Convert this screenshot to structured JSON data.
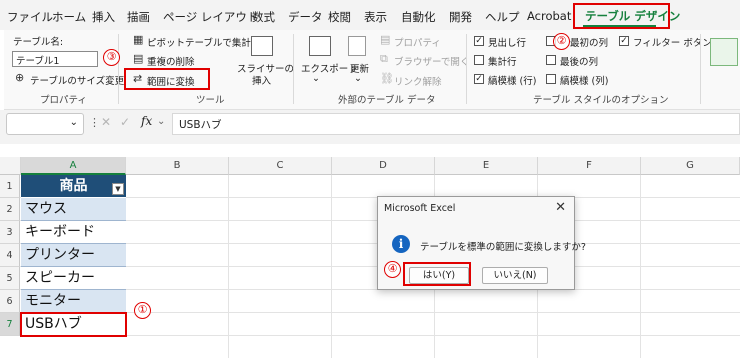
{
  "tabs": [
    "ファイル",
    "ホーム",
    "挿入",
    "描画",
    "ページ レイアウト",
    "数式",
    "データ",
    "校閲",
    "表示",
    "自動化",
    "開発",
    "ヘルプ",
    "Acrobat",
    "テーブル デザイン"
  ],
  "ribbon": {
    "properties": {
      "table_name_label": "テーブル名:",
      "table_name_value": "テーブル1",
      "resize_label": "テーブルのサイズ変更",
      "group_label": "プロパティ"
    },
    "tools": {
      "pivot_label": "ピボットテーブルで集計",
      "remove_dup_label": "重複の削除",
      "convert_label": "範囲に変換",
      "slicer_label_1": "スライサーの",
      "slicer_label_2": "挿入",
      "group_label": "ツール"
    },
    "external": {
      "export_label": "エクスポート",
      "refresh_label": "更新",
      "properties_label": "プロパティ",
      "browser_label": "ブラウザーで開く",
      "unlink_label": "リンク解除",
      "group_label": "外部のテーブル データ"
    },
    "style_options": {
      "header_row": {
        "label": "見出し行",
        "checked": true
      },
      "total_row": {
        "label": "集計行",
        "checked": false
      },
      "banded_rows": {
        "label": "縞模様 (行)",
        "checked": true
      },
      "first_column": {
        "label": "最初の列",
        "checked": false
      },
      "last_column": {
        "label": "最後の列",
        "checked": false
      },
      "banded_columns": {
        "label": "縞模様 (列)",
        "checked": false
      },
      "filter_button": {
        "label": "フィルター ボタン",
        "checked": true
      },
      "group_label": "テーブル スタイルのオプション"
    }
  },
  "formula_bar": {
    "fx": "fx",
    "content": "USBハブ"
  },
  "columns": [
    "A",
    "B",
    "C",
    "D",
    "E",
    "F",
    "G"
  ],
  "rows": [
    "1",
    "2",
    "3",
    "4",
    "5",
    "6",
    "7"
  ],
  "table": {
    "header": "商品",
    "items": [
      "マウス",
      "キーボード",
      "プリンター",
      "スピーカー",
      "モニター",
      "USBハブ"
    ]
  },
  "dialog": {
    "title": "Microsoft Excel",
    "close": "✕",
    "message": "テーブルを標準の範囲に変換しますか?",
    "yes": "はい(Y)",
    "no": "いいえ(N)"
  },
  "annotations": [
    "①",
    "②",
    "③",
    "④"
  ],
  "colors": {
    "accent": "#15803d",
    "table_header": "#1f4e78",
    "band": "#d9e5f2",
    "annotation": "#e00000"
  }
}
